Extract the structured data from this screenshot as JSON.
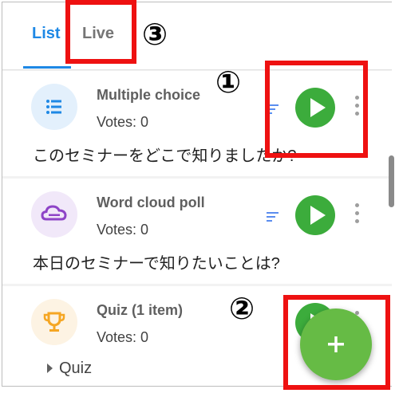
{
  "tabs": [
    {
      "label": "List",
      "active": true
    },
    {
      "label": "Live",
      "active": false
    }
  ],
  "polls": [
    {
      "title": "Multiple choice",
      "votes": "Votes: 0",
      "question": "このセミナーをどこで知りましたか?",
      "icon": "list-icon",
      "accent": "#1e88e5"
    },
    {
      "title": "Word cloud poll",
      "votes": "Votes: 0",
      "question": "本日のセミナーで知りたいことは?",
      "icon": "cloud-icon",
      "accent": "#8e44c7"
    },
    {
      "title": "Quiz (1 item)",
      "votes": "Votes: 0",
      "subitem": "Quiz",
      "icon": "trophy-icon",
      "accent": "#f5a623"
    }
  ],
  "annotations": {
    "mark_1": "①",
    "mark_2": "②",
    "mark_3": "③"
  },
  "colors": {
    "active_tab": "#1e88e5",
    "play_button": "#3cac3c",
    "fab": "#66bb45",
    "annotation_box": "#ee1111"
  }
}
